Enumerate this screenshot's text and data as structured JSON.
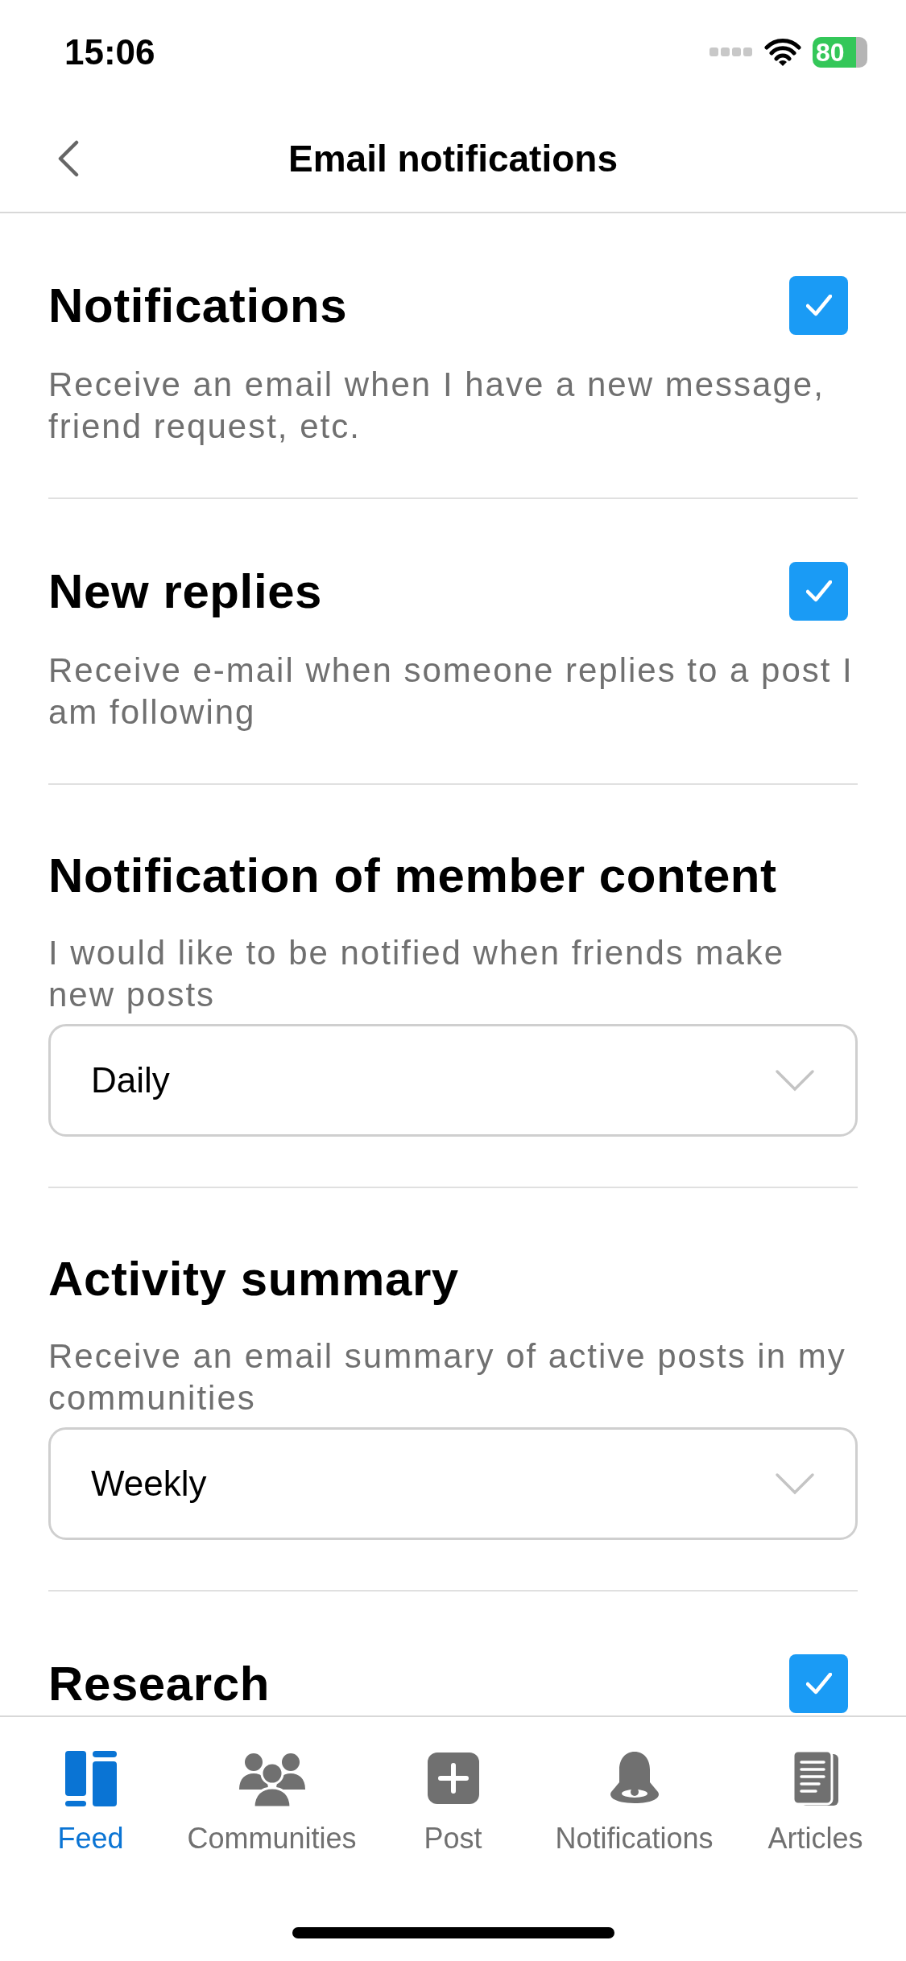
{
  "status_bar": {
    "time": "15:06",
    "battery": "80"
  },
  "nav": {
    "title": "Email notifications"
  },
  "sections": [
    {
      "kind": "checkbox",
      "title": "Notifications",
      "checked": true,
      "description": "Receive an email when I have a new message, friend request, etc."
    },
    {
      "kind": "checkbox",
      "title": "New replies",
      "checked": true,
      "description": "Receive e-mail when someone replies to a post I am following"
    },
    {
      "kind": "select",
      "title": "Notification of member content",
      "description": "I would like to be notified when friends make new posts",
      "value": "Daily"
    },
    {
      "kind": "select",
      "title": "Activity summary",
      "description": "Receive an email summary of active posts in my communities",
      "value": "Weekly"
    },
    {
      "kind": "checkbox",
      "title": "Research",
      "checked": true
    }
  ],
  "tab_bar": [
    {
      "kind": "feed",
      "label": "Feed",
      "selected": true
    },
    {
      "kind": "communities",
      "label": "Communities",
      "selected": false
    },
    {
      "kind": "post",
      "label": "Post",
      "selected": false
    },
    {
      "kind": "notifications",
      "label": "Notifications",
      "selected": false
    },
    {
      "kind": "articles",
      "label": "Articles",
      "selected": false
    }
  ]
}
